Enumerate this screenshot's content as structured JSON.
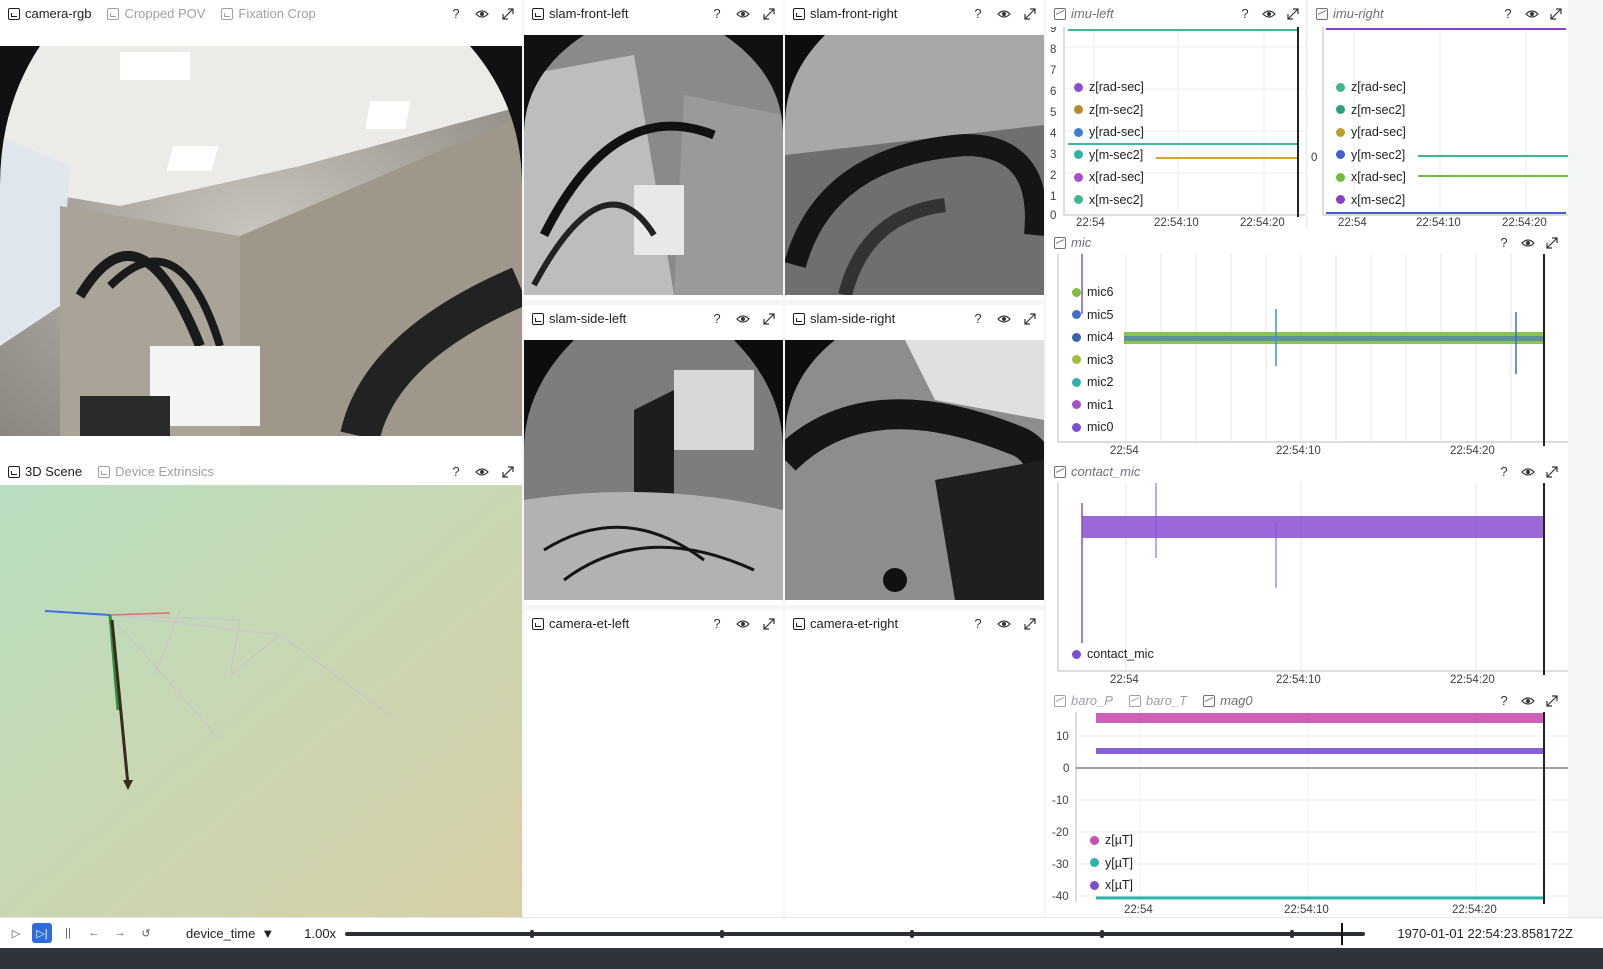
{
  "panels": {
    "camera_rgb": {
      "tabs": [
        {
          "label": "camera-rgb",
          "active": true
        },
        {
          "label": "Cropped POV",
          "active": false
        },
        {
          "label": "Fixation Crop",
          "active": false
        }
      ]
    },
    "scene3d": {
      "tabs": [
        {
          "label": "3D Scene",
          "active": true
        },
        {
          "label": "Device Extrinsics",
          "active": false
        }
      ]
    },
    "slam_front_left": {
      "title": "slam-front-left"
    },
    "slam_front_right": {
      "title": "slam-front-right"
    },
    "slam_side_left": {
      "title": "slam-side-left"
    },
    "slam_side_right": {
      "title": "slam-side-right"
    },
    "camera_et_left": {
      "title": "camera-et-left"
    },
    "camera_et_right": {
      "title": "camera-et-right"
    },
    "imu_left": {
      "title": "imu-left",
      "legend": [
        "z[rad-sec]",
        "z[m-sec2]",
        "y[rad-sec]",
        "y[m-sec2]",
        "x[rad-sec]",
        "x[m-sec2]"
      ],
      "yticks": [
        "9",
        "8",
        "7",
        "6",
        "5",
        "4",
        "3",
        "2",
        "1",
        "0"
      ],
      "xticks": [
        "22:54",
        "22:54:10",
        "22:54:20"
      ]
    },
    "imu_right": {
      "title": "imu-right",
      "legend": [
        "z[rad-sec]",
        "z[m-sec2]",
        "y[rad-sec]",
        "y[m-sec2]",
        "x[rad-sec]",
        "x[m-sec2]"
      ],
      "yticks": [
        "0"
      ],
      "xticks": [
        "22:54",
        "22:54:10",
        "22:54:20"
      ]
    },
    "mic": {
      "title": "mic",
      "legend": [
        "mic6",
        "mic5",
        "mic4",
        "mic3",
        "mic2",
        "mic1",
        "mic0"
      ],
      "xticks": [
        "22:54",
        "22:54:10",
        "22:54:20"
      ]
    },
    "contact_mic": {
      "title": "contact_mic",
      "legend": [
        "contact_mic"
      ],
      "xticks": [
        "22:54",
        "22:54:10",
        "22:54:20"
      ]
    },
    "mag": {
      "tabs": [
        {
          "label": "baro_P",
          "active": false
        },
        {
          "label": "baro_T",
          "active": false
        },
        {
          "label": "mag0",
          "active": true
        }
      ],
      "legend": [
        "z[µT]",
        "y[µT]",
        "x[µT]"
      ],
      "yticks": [
        "10",
        "0",
        "-10",
        "-20",
        "-30",
        "-40"
      ],
      "xticks": [
        "22:54",
        "22:54:10",
        "22:54:20"
      ]
    }
  },
  "toolbar_icons": {
    "help": "?",
    "visibility": "eye-icon",
    "maximize": "expand-icon"
  },
  "colors": {
    "accent": "#2d6cdf",
    "imu_green": "#3cb88a",
    "imu_orange": "#d9a32a",
    "mic_green": "#7fbf3a",
    "mic_blue": "#3f6fcf",
    "contact_purple": "#8a4fd0",
    "mag_pink": "#c94fb0",
    "mag_purple": "#7b4fd0",
    "mag_teal": "#2fb3a8"
  },
  "legend_colors": {
    "imu_left": [
      "#8a4fd0",
      "#b88a2a",
      "#3f7fd0",
      "#2fb3a8",
      "#a54fc9",
      "#3cb88a"
    ],
    "imu_right": [
      "#3cb88a",
      "#2f9f7a",
      "#b8a02a",
      "#3f5fd0",
      "#6fbf3a",
      "#8a3fc9"
    ],
    "mic": [
      "#7fbf3a",
      "#3f6fcf",
      "#3f5fb0",
      "#9fbf3a",
      "#2fb3a8",
      "#a54fc9",
      "#7b4fd0"
    ],
    "contact_mic": [
      "#7b4fd0"
    ],
    "mag": [
      "#c94fb0",
      "#2fb3a8",
      "#7b4fd0"
    ]
  },
  "timeline": {
    "time_selector": "device_time",
    "speed": "1.00x",
    "timestamp": "1970-01-01 22:54:23.858172Z"
  }
}
